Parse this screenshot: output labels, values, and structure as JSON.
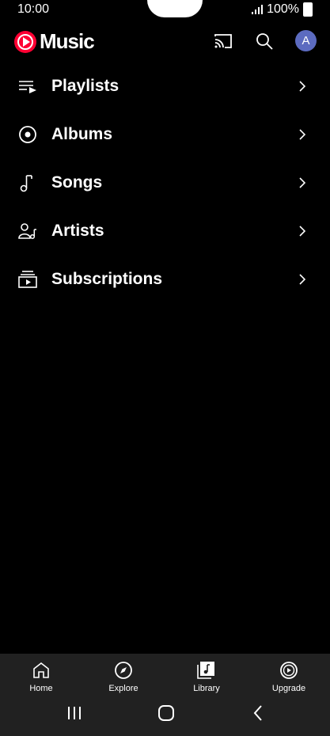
{
  "status_bar": {
    "time": "10:00",
    "battery": "100%"
  },
  "app": {
    "name": "Music"
  },
  "header": {
    "avatar_letter": "A"
  },
  "library_items": [
    {
      "label": "Playlists",
      "icon": "playlist-icon"
    },
    {
      "label": "Albums",
      "icon": "album-icon"
    },
    {
      "label": "Songs",
      "icon": "music-note-icon"
    },
    {
      "label": "Artists",
      "icon": "artist-icon"
    },
    {
      "label": "Subscriptions",
      "icon": "subscriptions-icon"
    }
  ],
  "bottom_nav": [
    {
      "label": "Home",
      "icon": "home-icon"
    },
    {
      "label": "Explore",
      "icon": "compass-icon"
    },
    {
      "label": "Library",
      "icon": "library-icon"
    },
    {
      "label": "Upgrade",
      "icon": "upgrade-icon"
    }
  ],
  "theme": {
    "background": "#000000",
    "accent": "#ff0033",
    "nav_bg": "#212121",
    "avatar_bg": "#5c6bc0"
  }
}
